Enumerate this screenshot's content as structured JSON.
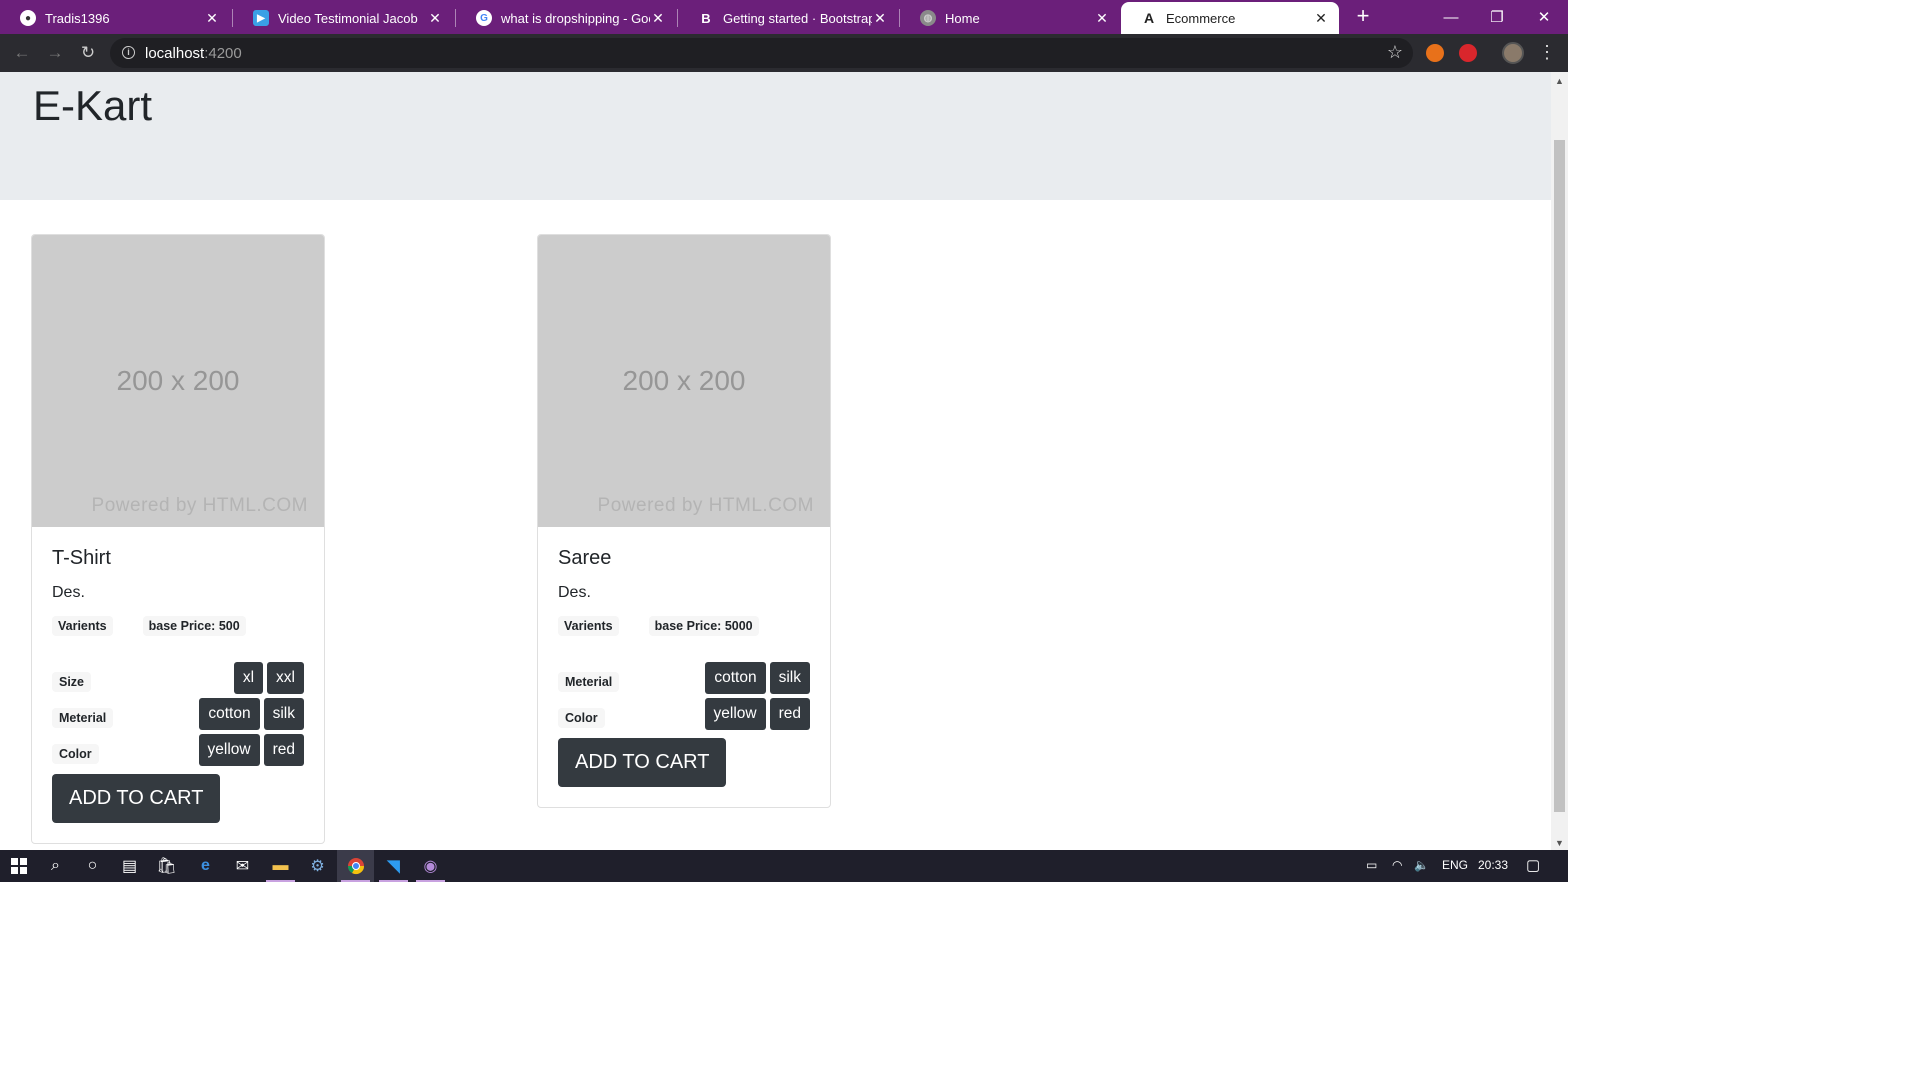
{
  "browser": {
    "tabs": [
      {
        "label": "Tradis1396",
        "icon": "github-icon"
      },
      {
        "label": "Video Testimonial Jacob",
        "icon": "video-icon"
      },
      {
        "label": "what is dropshipping - Goog",
        "icon": "google-icon"
      },
      {
        "label": "Getting started · Bootstrap",
        "icon": "bootstrap-icon"
      },
      {
        "label": "Home",
        "icon": "globe-icon"
      },
      {
        "label": "Ecommerce",
        "icon": "angular-icon"
      }
    ],
    "active_tab": 5,
    "url_host": "localhost",
    "url_port": ":4200"
  },
  "page": {
    "title": "E-Kart",
    "products": [
      {
        "name": "T-Shirt",
        "description": "Des.",
        "image_dims": "200 x 200",
        "image_credit": "Powered by HTML.COM",
        "variants_label": "Varients",
        "base_price": "base Price: 500",
        "options": [
          {
            "label": "Size",
            "values": [
              "xl",
              "xxl"
            ]
          },
          {
            "label": "Meterial",
            "values": [
              "cotton",
              "silk"
            ]
          },
          {
            "label": "Color",
            "values": [
              "yellow",
              "red"
            ]
          }
        ],
        "add_to_cart": "ADD TO CART"
      },
      {
        "name": "Saree",
        "description": "Des.",
        "image_dims": "200 x 200",
        "image_credit": "Powered by HTML.COM",
        "variants_label": "Varients",
        "base_price": "base Price: 5000",
        "options": [
          {
            "label": "Meterial",
            "values": [
              "cotton",
              "silk"
            ]
          },
          {
            "label": "Color",
            "values": [
              "yellow",
              "red"
            ]
          }
        ],
        "add_to_cart": "ADD TO CART"
      }
    ]
  },
  "taskbar": {
    "language": "ENG",
    "time": "20:33"
  },
  "colors": {
    "tabbar": "#6b1f7a",
    "jumbotron": "#e9ecef",
    "button_dark": "#343a40"
  }
}
